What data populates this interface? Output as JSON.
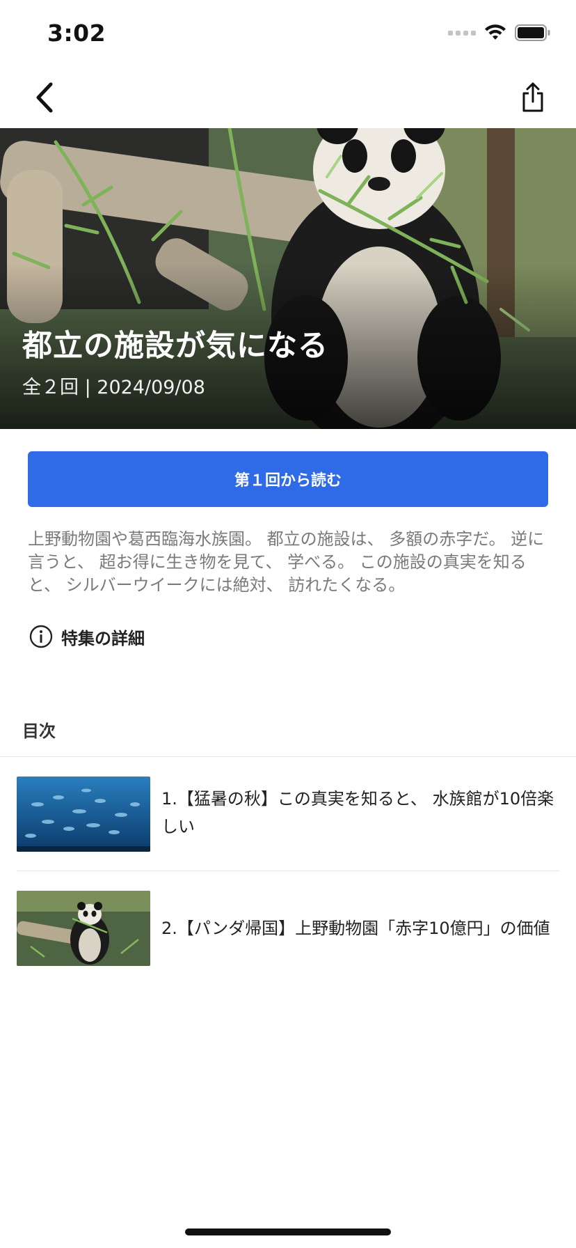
{
  "status_bar": {
    "time": "3:02",
    "icons": [
      "cellular-signal-icon",
      "wifi-icon",
      "battery-icon"
    ]
  },
  "nav": {
    "back_icon": "chevron-left-icon",
    "share_icon": "share-icon"
  },
  "hero": {
    "title": "都立の施設が気になる",
    "meta": "全２回 | 2024/09/08"
  },
  "read_button": {
    "label": "第１回から読む"
  },
  "description": "上野動物園や葛西臨海水族園。 都立の施設は、 多額の赤字だ。 逆に言うと、 超お得に生き物を見て、 学べる。 この施設の真実を知ると、 シルバーウイークには絶対、 訪れたくなる。",
  "details": {
    "icon": "info-icon",
    "label": "特集の詳細"
  },
  "toc": {
    "heading": "目次",
    "items": [
      {
        "title": "1.【猛暑の秋】この真実を知ると、 水族館が10倍楽しい",
        "thumbnail": "aquarium-fish-thumbnail"
      },
      {
        "title": "2.【パンダ帰国】上野動物園「赤字10億円」の価値",
        "thumbnail": "panda-thumbnail"
      }
    ]
  },
  "colors": {
    "accent": "#2f6be6",
    "text_primary": "#222222",
    "text_secondary": "#7a7a7a",
    "divider": "#e3e3e3"
  }
}
